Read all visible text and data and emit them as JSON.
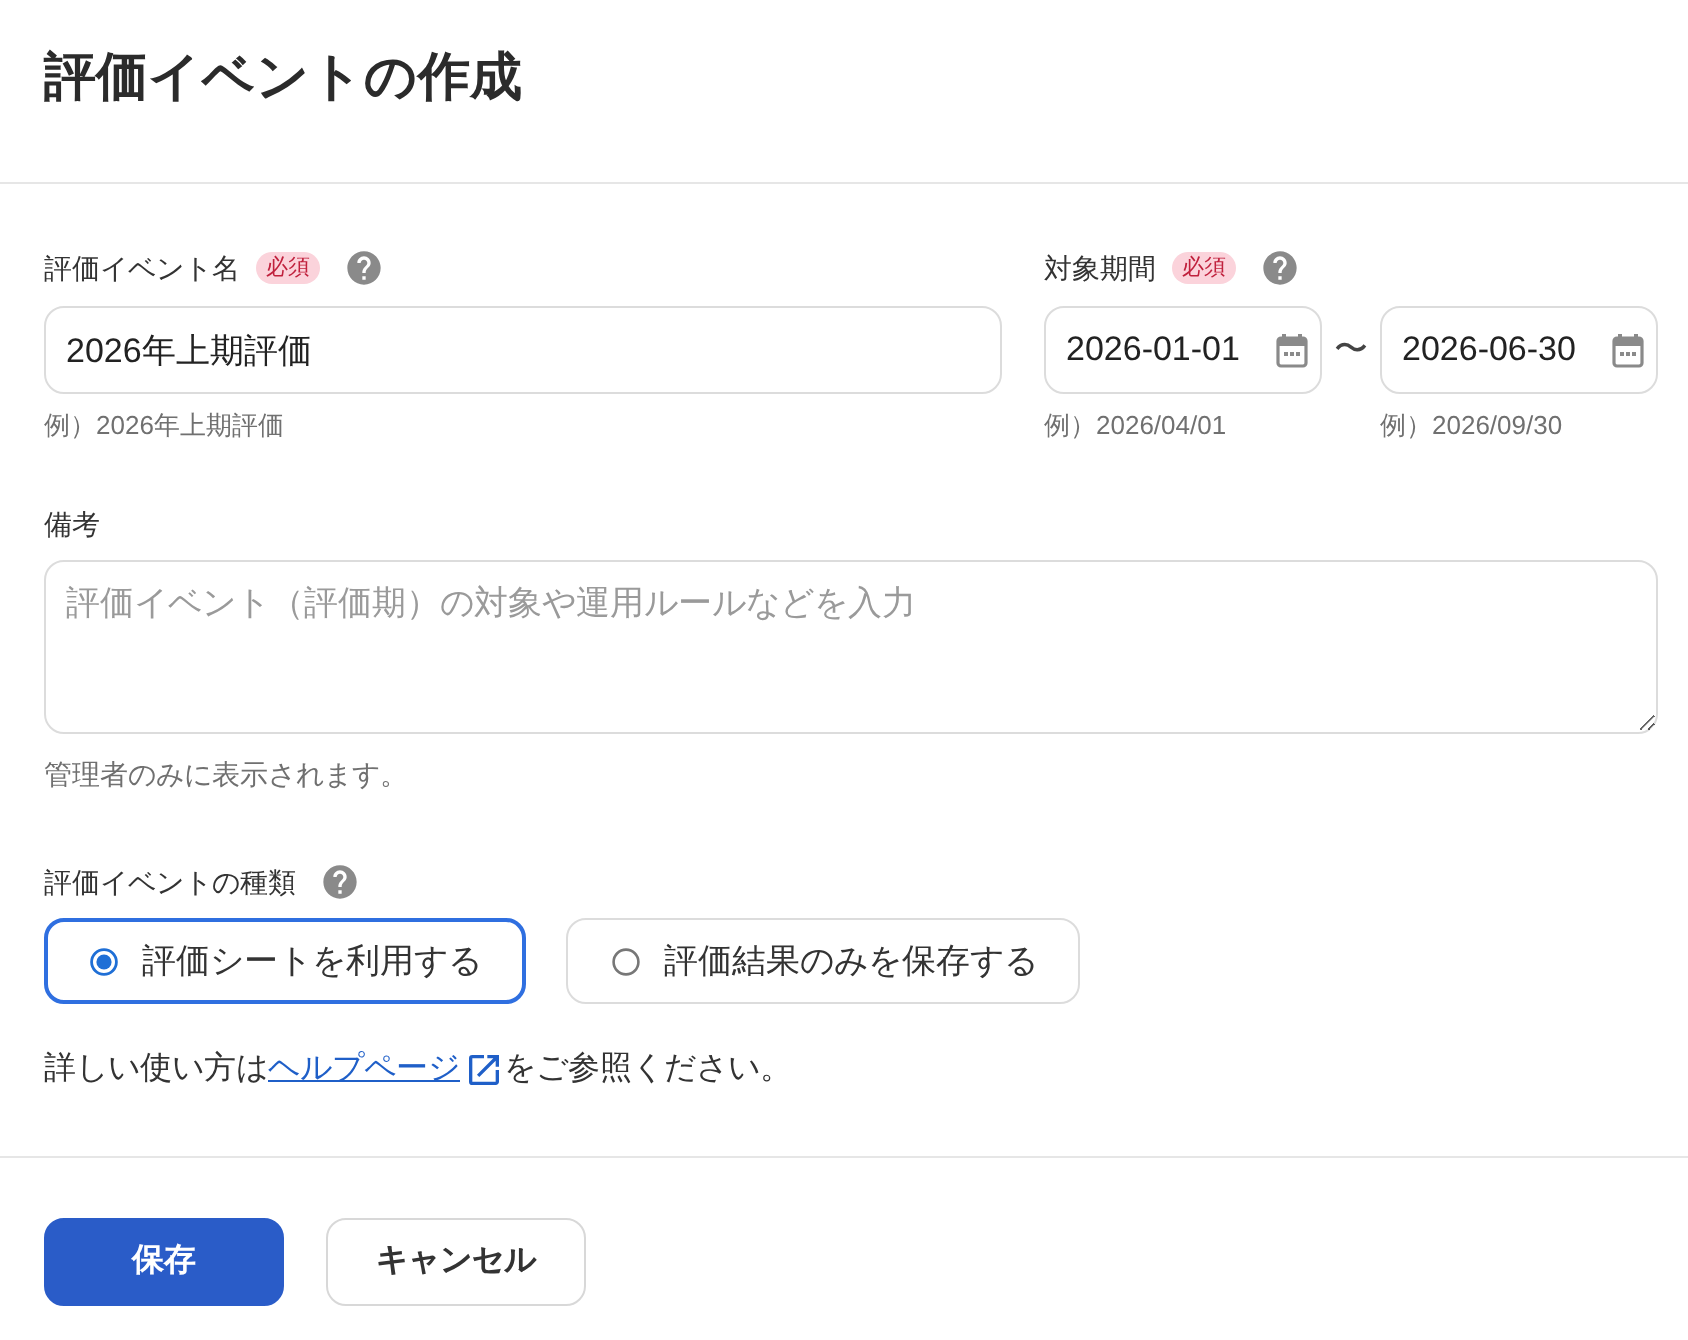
{
  "page": {
    "title": "評価イベントの作成"
  },
  "event_name": {
    "label": "評価イベント名",
    "required_badge": "必須",
    "value": "2026年上期評価",
    "hint": "例）2026年上期評価"
  },
  "period": {
    "label": "対象期間",
    "required_badge": "必須",
    "start": {
      "value": "2026-01-01",
      "hint": "例）2026/04/01"
    },
    "separator": "〜",
    "end": {
      "value": "2026-06-30",
      "hint": "例）2026/09/30"
    }
  },
  "notes": {
    "label": "備考",
    "placeholder": "評価イベント（評価期）の対象や運用ルールなどを入力",
    "hint": "管理者のみに表示されます。"
  },
  "event_type": {
    "label": "評価イベントの種類",
    "options": [
      {
        "label": "評価シートを利用する",
        "selected": true
      },
      {
        "label": "評価結果のみを保存する",
        "selected": false
      }
    ]
  },
  "help": {
    "before": "詳しい使い方は",
    "link": "ヘルプページ",
    "after": "をご参照ください。"
  },
  "buttons": [
    {
      "label": "保存",
      "kind": "primary"
    },
    {
      "label": "キャンセル",
      "kind": "secondary"
    }
  ]
}
